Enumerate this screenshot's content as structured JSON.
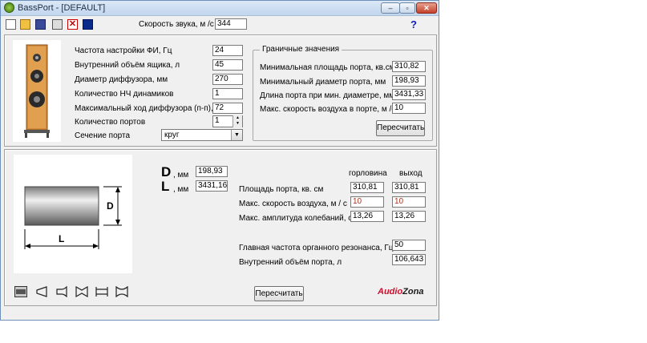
{
  "window": {
    "title": "BassPort - [DEFAULT]",
    "minimize_glyph": "–",
    "restore_glyph": "▫",
    "close_glyph": "✕"
  },
  "toolbar": {
    "delete_glyph": "✕",
    "sound_speed_label": "Скорость звука, м /с",
    "sound_speed_value": "344",
    "help_glyph": "?"
  },
  "params": {
    "rows": [
      {
        "label": "Частота настройки ФИ, Гц",
        "value": "24"
      },
      {
        "label": "Внутренний объём ящика, л",
        "value": "45"
      },
      {
        "label": "Диаметр диффузора, мм",
        "value": "270"
      },
      {
        "label": "Количество НЧ динамиков",
        "value": "1"
      },
      {
        "label": "Максимальный ход диффузора (п-п), мм",
        "value": "72"
      },
      {
        "label": "Количество портов",
        "value": "1"
      }
    ],
    "section_label": "Сечение порта",
    "section_value": "круг"
  },
  "limits": {
    "title": "Граничные значения",
    "rows": [
      {
        "label": "Минимальная площадь порта, кв.см.",
        "value": "310,82"
      },
      {
        "label": "Минимальный диаметр порта, мм",
        "value": "198,93"
      },
      {
        "label": "Длина порта при мин. диаметре, мм",
        "value": "3431,33"
      },
      {
        "label": "Макс. скорость воздуха в порте, м /с",
        "value": "10"
      }
    ],
    "recalc_label": "Пересчитать"
  },
  "diagram": {
    "d_letter": "D",
    "l_letter": "L"
  },
  "results": {
    "d_big": "D",
    "d_unit": ", мм",
    "d_value": "198,93",
    "l_big": "L",
    "l_unit": ", мм",
    "l_value": "3431,16",
    "col_throat": "горловина",
    "col_exit": "выход",
    "rows": [
      {
        "label": "Площадь порта, кв. см",
        "throat": "310,81",
        "exit": "310,81"
      },
      {
        "label": "Макс. скорость воздуха, м / с",
        "throat": "10",
        "exit": "10"
      },
      {
        "label": "Макс. амплитуда колебаний, см",
        "throat": "13,26",
        "exit": "13,26"
      }
    ],
    "resonance_label": "Главная частота органного резонанса, Гц",
    "resonance_value": "50",
    "volume_label": "Внутренний объём порта, л",
    "volume_value": "106,643",
    "recalc_label": "Пересчитать",
    "brand_part1": "Audio",
    "brand_part2": "Zona"
  },
  "colors": {
    "brand_red": "#c8102e",
    "brand_dark": "#1a1a1a",
    "value_red": "#b03020"
  }
}
